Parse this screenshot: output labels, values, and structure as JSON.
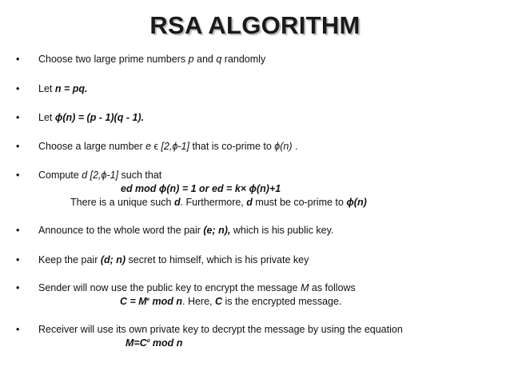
{
  "title": "RSA ALGORITHM",
  "bullet_char": "•",
  "items": {
    "choose": {
      "prefix": "Choose two large prime numbers ",
      "p": "p",
      "and": " and ",
      "q": "q",
      "suffix": " randomly"
    },
    "let_n": {
      "prefix": "Let ",
      "expr": "n = pq."
    },
    "let_phi": {
      "prefix": "Let  ",
      "expr": "ϕ(n)  = (p - 1)(q -  1)."
    },
    "choose_e": {
      "prefix": "Choose a large number ",
      "e": "e",
      "in": " ϵ ",
      "range": "[2,ϕ-1]",
      "middle": " that is co-prime to ",
      "phi": "ϕ(n)",
      "suffix": " ."
    },
    "compute_d": {
      "prefix": "Compute ",
      "d": "d",
      "range": "  [2,ϕ-1]",
      "suffix": " such that",
      "eq": "ed mod ϕ(n) =  1 or ed = k× ϕ(n)+1",
      "unique_prefix": "There is a unique such ",
      "unique_d": "d",
      "unique_mid": ". Furthermore, ",
      "unique_d2": "d",
      "unique_suffix": " must be co-prime to ",
      "unique_phi": "ϕ(n)"
    },
    "announce": {
      "prefix": "Announce to the whole word the pair ",
      "pair": "(e; n),",
      "suffix": " which is his public key."
    },
    "keep": {
      "prefix": "Keep the pair ",
      "pair": "(d; n)",
      "suffix": " secret to himself, which is his private key"
    },
    "sender": {
      "prefix": "Sender will now use the public key to encrypt the message ",
      "M": "M",
      "suffix": " as follows",
      "eq_prefix": "C = M",
      "eq_sup": "e",
      "eq_mod": " mod n",
      "eq_mid": ". Here, ",
      "eq_C": "C",
      "eq_suffix": " is the encrypted message."
    },
    "receiver": {
      "text": "Receiver will use its own private key to decrypt the message by using the equation",
      "eq_prefix": "M=C",
      "eq_sup": "d",
      "eq_suffix": " mod n"
    }
  }
}
